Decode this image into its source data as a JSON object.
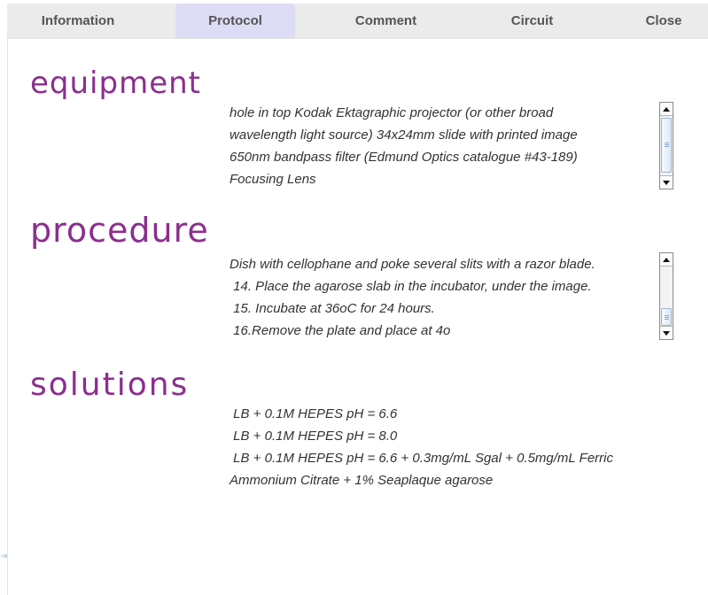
{
  "tabs": [
    {
      "label": "Information"
    },
    {
      "label": "Protocol"
    },
    {
      "label": "Comment"
    },
    {
      "label": "Circuit"
    },
    {
      "label": "Close"
    }
  ],
  "active_tab": "Protocol",
  "sections": {
    "equipment": {
      "heading": "equipment",
      "lines": [
        "hole in top Kodak Ektagraphic projector (or other broad",
        "wavelength light source) 34x24mm slide with printed image",
        "650nm bandpass filter (Edmund Optics catalogue #43-189)",
        "Focusing Lens"
      ]
    },
    "procedure": {
      "heading": "procedure",
      "lines": [
        "Dish with cellophane and poke several slits with a razor blade.",
        " 14. Place the agarose slab in the incubator, under the image.",
        " 15. Incubate at 36oC for 24 hours.",
        " 16.Remove the plate and place at 4o"
      ]
    },
    "solutions": {
      "heading": "solutions",
      "lines": [
        " LB + 0.1M HEPES pH = 6.6",
        " LB + 0.1M HEPES pH = 8.0",
        " LB + 0.1M HEPES pH = 6.6 + 0.3mg/mL Sgal + 0.5mg/mL Ferric",
        "Ammonium Citrate + 1% Seaplaque agarose"
      ]
    }
  },
  "colors": {
    "heading": "#8b2e8f",
    "active_tab": "#dcdcf5",
    "tabbar": "#ebebeb"
  }
}
